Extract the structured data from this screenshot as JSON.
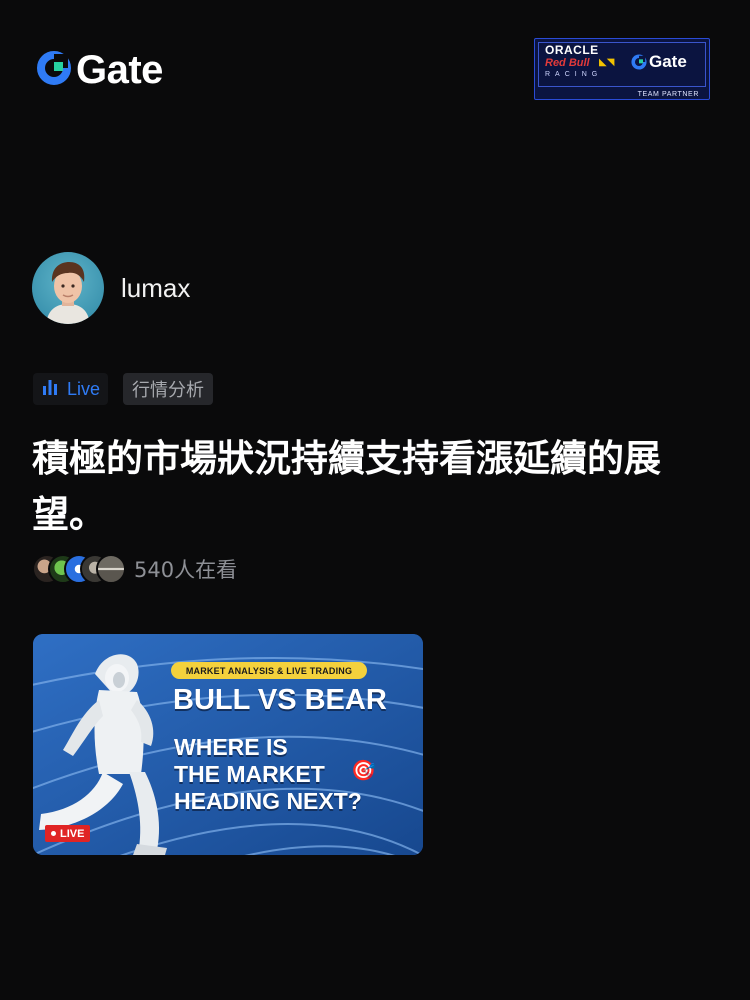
{
  "header": {
    "brand": "Gate",
    "brand_color": "#2f7bf5",
    "partner_badge": {
      "line1": "ORACLE",
      "line2": "Red Bull",
      "line3": "RACING",
      "brand": "Gate",
      "caption": "TEAM PARTNER"
    }
  },
  "post": {
    "author": {
      "name": "lumax",
      "avatar_icon": "user-avatar"
    },
    "tags": [
      {
        "label": "Live",
        "icon": "bar-chart-icon",
        "color": "#2f7bf5"
      },
      {
        "label": "行情分析"
      }
    ],
    "title": "積極的市場狀況持續支持看漲延續的展望。",
    "viewers": {
      "text": "540人在看",
      "avatar_count": 4
    },
    "thumbnail": {
      "kicker": "MARKET ANALYSIS & LIVE TRADING",
      "headline": "BULL VS BEAR",
      "subline": [
        "WHERE IS",
        "THE MARKET",
        "HEADING NEXT?"
      ],
      "target_icon": "🎯",
      "live_label": "LIVE"
    }
  }
}
